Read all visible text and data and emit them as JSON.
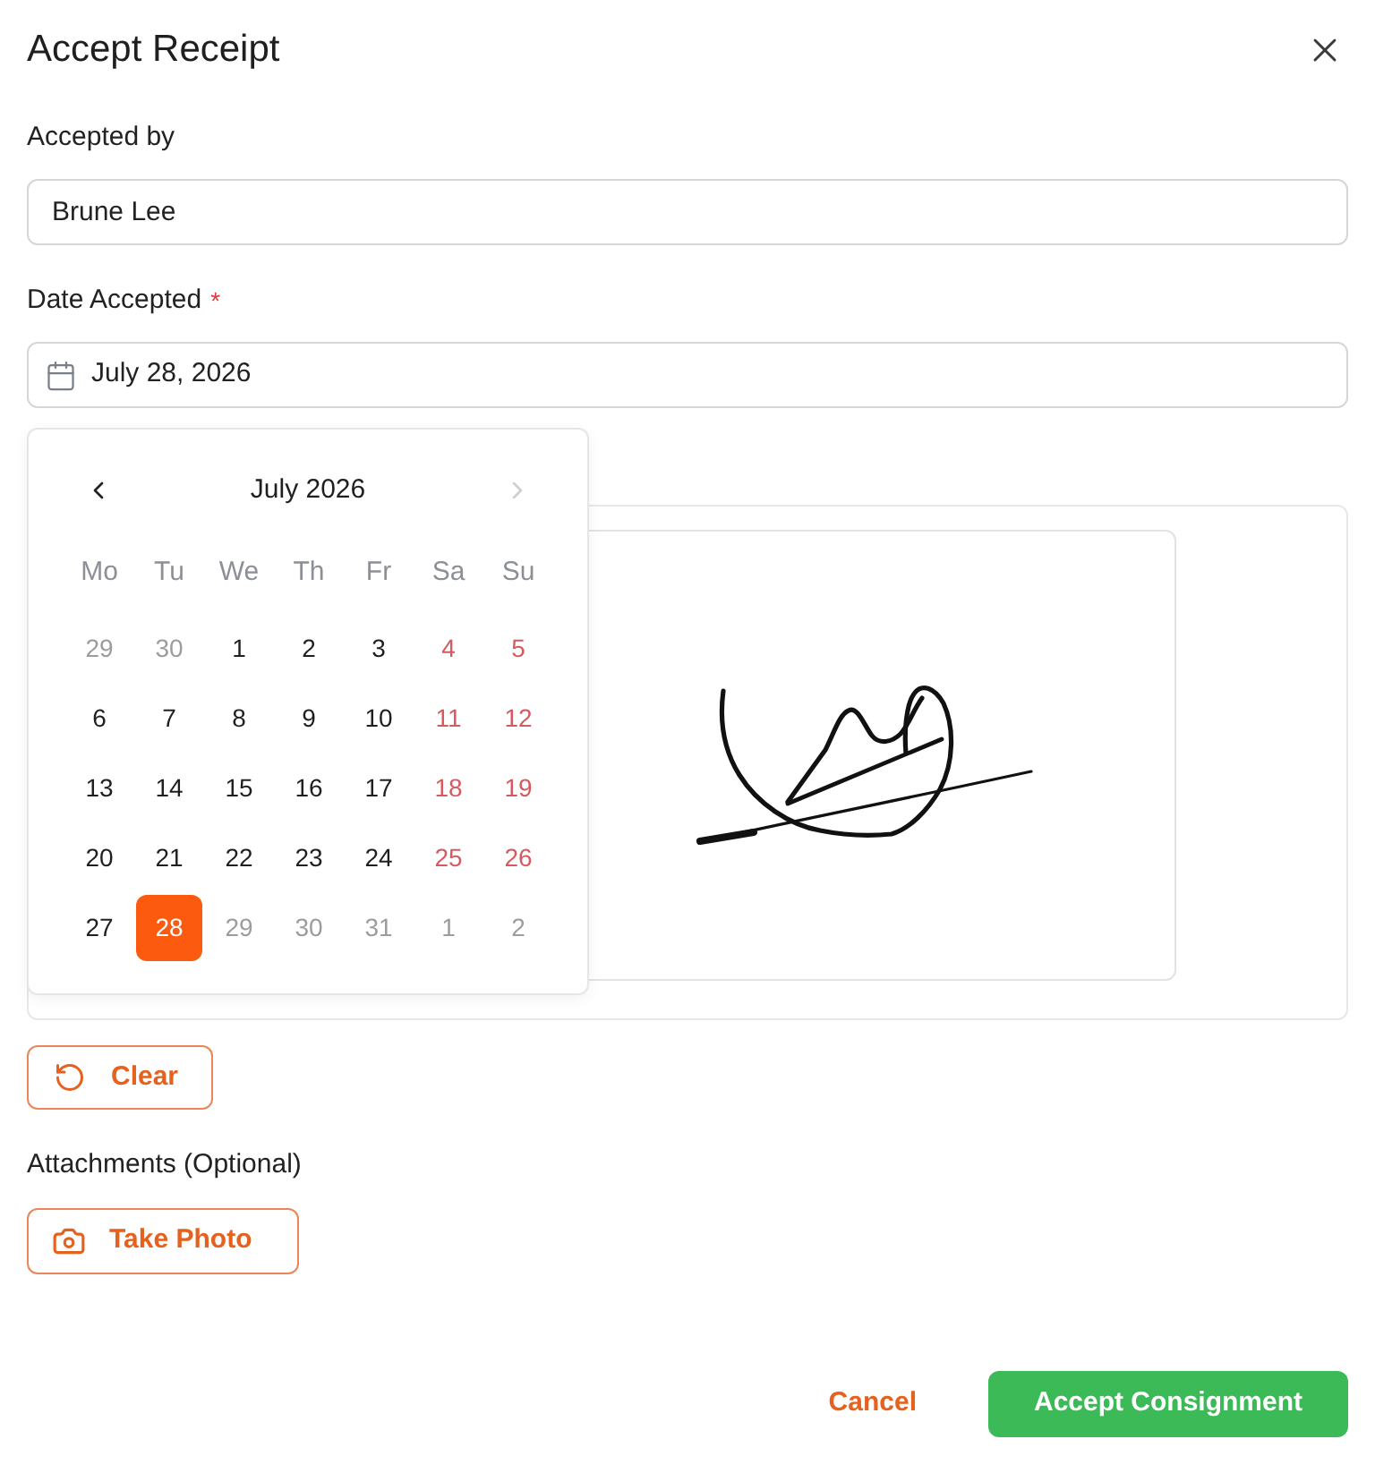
{
  "dialog": {
    "title": "Accept Receipt"
  },
  "accepted_by": {
    "label": "Accepted by",
    "value": "Brune Lee"
  },
  "date_accepted": {
    "label": "Date Accepted",
    "required_mark": "*",
    "value": "July 28, 2026"
  },
  "calendar": {
    "title": "July 2026",
    "prev_disabled": false,
    "next_disabled": true,
    "weekdays": [
      "Mo",
      "Tu",
      "We",
      "Th",
      "Fr",
      "Sa",
      "Su"
    ],
    "weeks": [
      [
        {
          "day": "29",
          "kind": "muted",
          "selected": false
        },
        {
          "day": "30",
          "kind": "muted",
          "selected": false
        },
        {
          "day": "1",
          "kind": "weekday",
          "selected": false
        },
        {
          "day": "2",
          "kind": "weekday",
          "selected": false
        },
        {
          "day": "3",
          "kind": "weekday",
          "selected": false
        },
        {
          "day": "4",
          "kind": "weekend",
          "selected": false
        },
        {
          "day": "5",
          "kind": "weekend",
          "selected": false
        }
      ],
      [
        {
          "day": "6",
          "kind": "weekday",
          "selected": false
        },
        {
          "day": "7",
          "kind": "weekday",
          "selected": false
        },
        {
          "day": "8",
          "kind": "weekday",
          "selected": false
        },
        {
          "day": "9",
          "kind": "weekday",
          "selected": false
        },
        {
          "day": "10",
          "kind": "weekday",
          "selected": false
        },
        {
          "day": "11",
          "kind": "weekend",
          "selected": false
        },
        {
          "day": "12",
          "kind": "weekend",
          "selected": false
        }
      ],
      [
        {
          "day": "13",
          "kind": "weekday",
          "selected": false
        },
        {
          "day": "14",
          "kind": "weekday",
          "selected": false
        },
        {
          "day": "15",
          "kind": "weekday",
          "selected": false
        },
        {
          "day": "16",
          "kind": "weekday",
          "selected": false
        },
        {
          "day": "17",
          "kind": "weekday",
          "selected": false
        },
        {
          "day": "18",
          "kind": "weekend",
          "selected": false
        },
        {
          "day": "19",
          "kind": "weekend",
          "selected": false
        }
      ],
      [
        {
          "day": "20",
          "kind": "weekday",
          "selected": false
        },
        {
          "day": "21",
          "kind": "weekday",
          "selected": false
        },
        {
          "day": "22",
          "kind": "weekday",
          "selected": false
        },
        {
          "day": "23",
          "kind": "weekday",
          "selected": false
        },
        {
          "day": "24",
          "kind": "weekday",
          "selected": false
        },
        {
          "day": "25",
          "kind": "weekend",
          "selected": false
        },
        {
          "day": "26",
          "kind": "weekend",
          "selected": false
        }
      ],
      [
        {
          "day": "27",
          "kind": "weekday",
          "selected": false
        },
        {
          "day": "28",
          "kind": "weekday",
          "selected": true
        },
        {
          "day": "29",
          "kind": "muted",
          "selected": false
        },
        {
          "day": "30",
          "kind": "muted",
          "selected": false
        },
        {
          "day": "31",
          "kind": "muted",
          "selected": false
        },
        {
          "day": "1",
          "kind": "muted",
          "selected": false
        },
        {
          "day": "2",
          "kind": "muted",
          "selected": false
        }
      ]
    ]
  },
  "signature": {
    "clear_button": "Clear"
  },
  "attachments": {
    "label": "Attachments (Optional)",
    "button": "Take Photo"
  },
  "footer": {
    "cancel": "Cancel",
    "confirm": "Accept Consignment"
  }
}
